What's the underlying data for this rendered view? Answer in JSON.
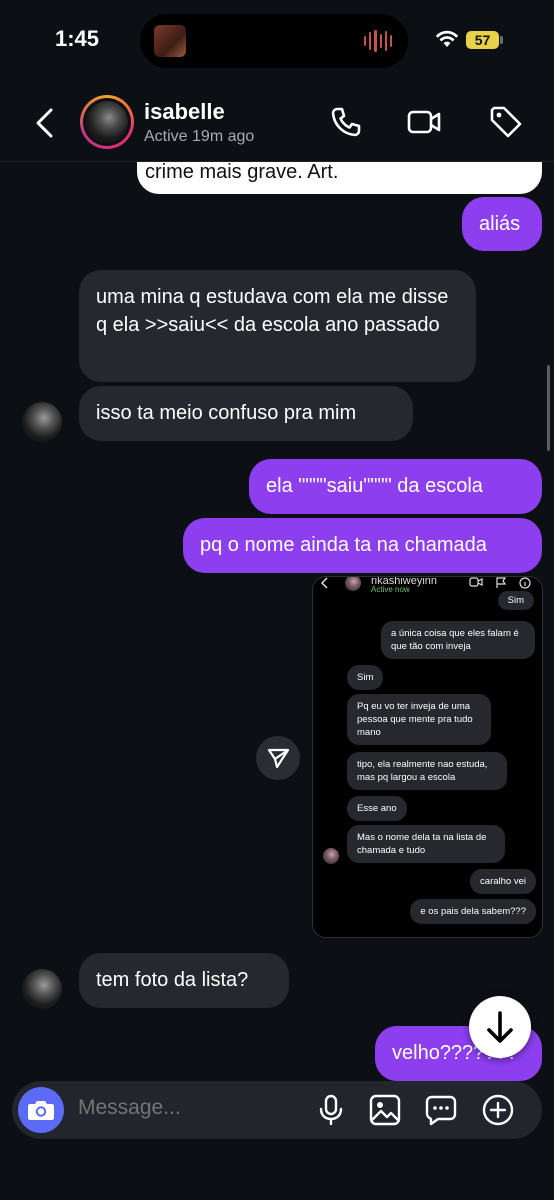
{
  "status_bar": {
    "time": "1:45",
    "battery": "57"
  },
  "header": {
    "contact_name": "isabelle",
    "contact_status": "Active 19m ago",
    "icons": [
      "back-chevron-icon",
      "phone-icon",
      "video-camera-icon",
      "tag-icon"
    ]
  },
  "messages": [
    {
      "id": "m0",
      "direction": "incoming",
      "text": "crime mais grave. Art.",
      "style": "quoted-reply"
    },
    {
      "id": "m1",
      "direction": "outgoing",
      "text": "aliás"
    },
    {
      "id": "m2",
      "direction": "incoming",
      "text": "uma mina q estudava com ela me disse q ela >>saiu<< da escola ano passado"
    },
    {
      "id": "m3",
      "direction": "incoming",
      "text": "isso ta meio confuso pra mim"
    },
    {
      "id": "m4",
      "direction": "outgoing",
      "text": "ela \"\"\"\"saiu\"\"\"\" da escola"
    },
    {
      "id": "m5",
      "direction": "outgoing",
      "text": "pq o nome ainda ta na chamada"
    },
    {
      "id": "m6",
      "direction": "incoming",
      "text": "tem foto da lista?"
    },
    {
      "id": "m7",
      "direction": "outgoing",
      "text": "velho???????"
    }
  ],
  "shared_screenshot": {
    "name": "rikashiweyinn",
    "status": "Active now",
    "messages": [
      {
        "dir": "out",
        "text": "Sim"
      },
      {
        "dir": "out",
        "text": "a única coisa que eles falam é que tão com inveja"
      },
      {
        "dir": "in",
        "text": "Sim"
      },
      {
        "dir": "in",
        "text": "Pq eu vo ter inveja de uma pessoa que mente pra tudo mano"
      },
      {
        "dir": "in",
        "text": "tipo, ela realmente nao estuda, mas pq largou a escola"
      },
      {
        "dir": "in",
        "text": "Esse ano"
      },
      {
        "dir": "in",
        "text": "Mas o nome dela ta na lista de chamada e tudo"
      },
      {
        "dir": "out",
        "text": "caralho vei"
      },
      {
        "dir": "out",
        "text": "e os pais dela sabem???"
      }
    ]
  },
  "composer": {
    "placeholder": "Message...",
    "icons": [
      "camera-icon",
      "microphone-icon",
      "gallery-icon",
      "sticker-chat-icon",
      "plus-icon"
    ]
  },
  "colors": {
    "background": "#0c0f14",
    "incoming_bubble": "#25282f",
    "outgoing_bubble": "#8d3ff0",
    "camera_button": "#5b6bf5"
  }
}
